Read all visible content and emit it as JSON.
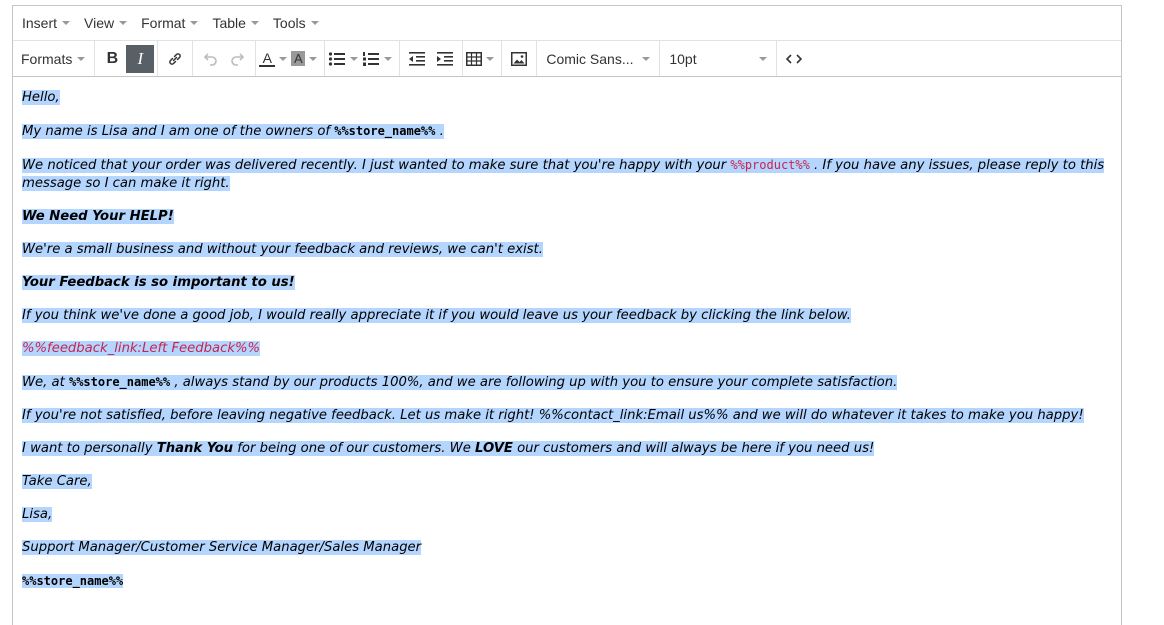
{
  "menubar": {
    "items": [
      "Insert",
      "View",
      "Format",
      "Table",
      "Tools"
    ]
  },
  "toolbar": {
    "formats_label": "Formats",
    "bold_label": "B",
    "italic_label": "I",
    "text_color_label": "A",
    "bg_color_label": "A",
    "font_family": "Comic Sans...",
    "font_size": "10pt",
    "icons": [
      "bold-icon",
      "italic-icon",
      "link-icon",
      "undo-icon",
      "redo-icon",
      "text-color-icon",
      "background-color-icon",
      "bullet-list-icon",
      "numbered-list-icon",
      "outdent-icon",
      "indent-icon",
      "table-icon",
      "image-icon",
      "source-code-icon"
    ]
  },
  "content": {
    "p1": "Hello,",
    "p2_text": "My name is Lisa and I am one of the owners of ",
    "p2_tag": "%%store_name%%",
    "p2_end": " .",
    "p3_text": "We noticed that your order was delivered recently. I just wanted to make sure that you're happy with your ",
    "p3_tag": "%%product%%",
    "p3_end": " . If you have any issues, please reply to this message so I can make it right.",
    "p4": "We Need Your HELP!",
    "p5": "We're a small business and without your feedback and reviews, we can't exist.",
    "p6": "Your Feedback is so important to us!",
    "p7": "If you think we've done a good job, I would really appreciate it if you would leave us your feedback by clicking the link below.",
    "p8": "%%feedback_link:Left Feedback%%",
    "p9_text": "We, at ",
    "p9_tag": "%%store_name%%",
    "p9_end": " , always stand by our products 100%, and we are following up with you to ensure your complete satisfaction.",
    "p10": "If you're not satisfied, before leaving negative feedback. Let us make it right! %%contact_link:Email us%% and we will do whatever it takes to make you happy!",
    "p11_a": "I want to personally ",
    "p11_b": "Thank You",
    "p11_c": " for being one of our customers. We ",
    "p11_d": "LOVE",
    "p11_e": " our customers and will always be here if you need us!",
    "p12": "Take Care,",
    "p13": "Lisa,",
    "p14": "Support Manager/Customer Service Manager/Sales Manager",
    "p15": "%%store_name%%"
  },
  "colors": {
    "selection": "#b4d5fe",
    "active_button": "#595f67",
    "template_tag": "#c7254e"
  }
}
